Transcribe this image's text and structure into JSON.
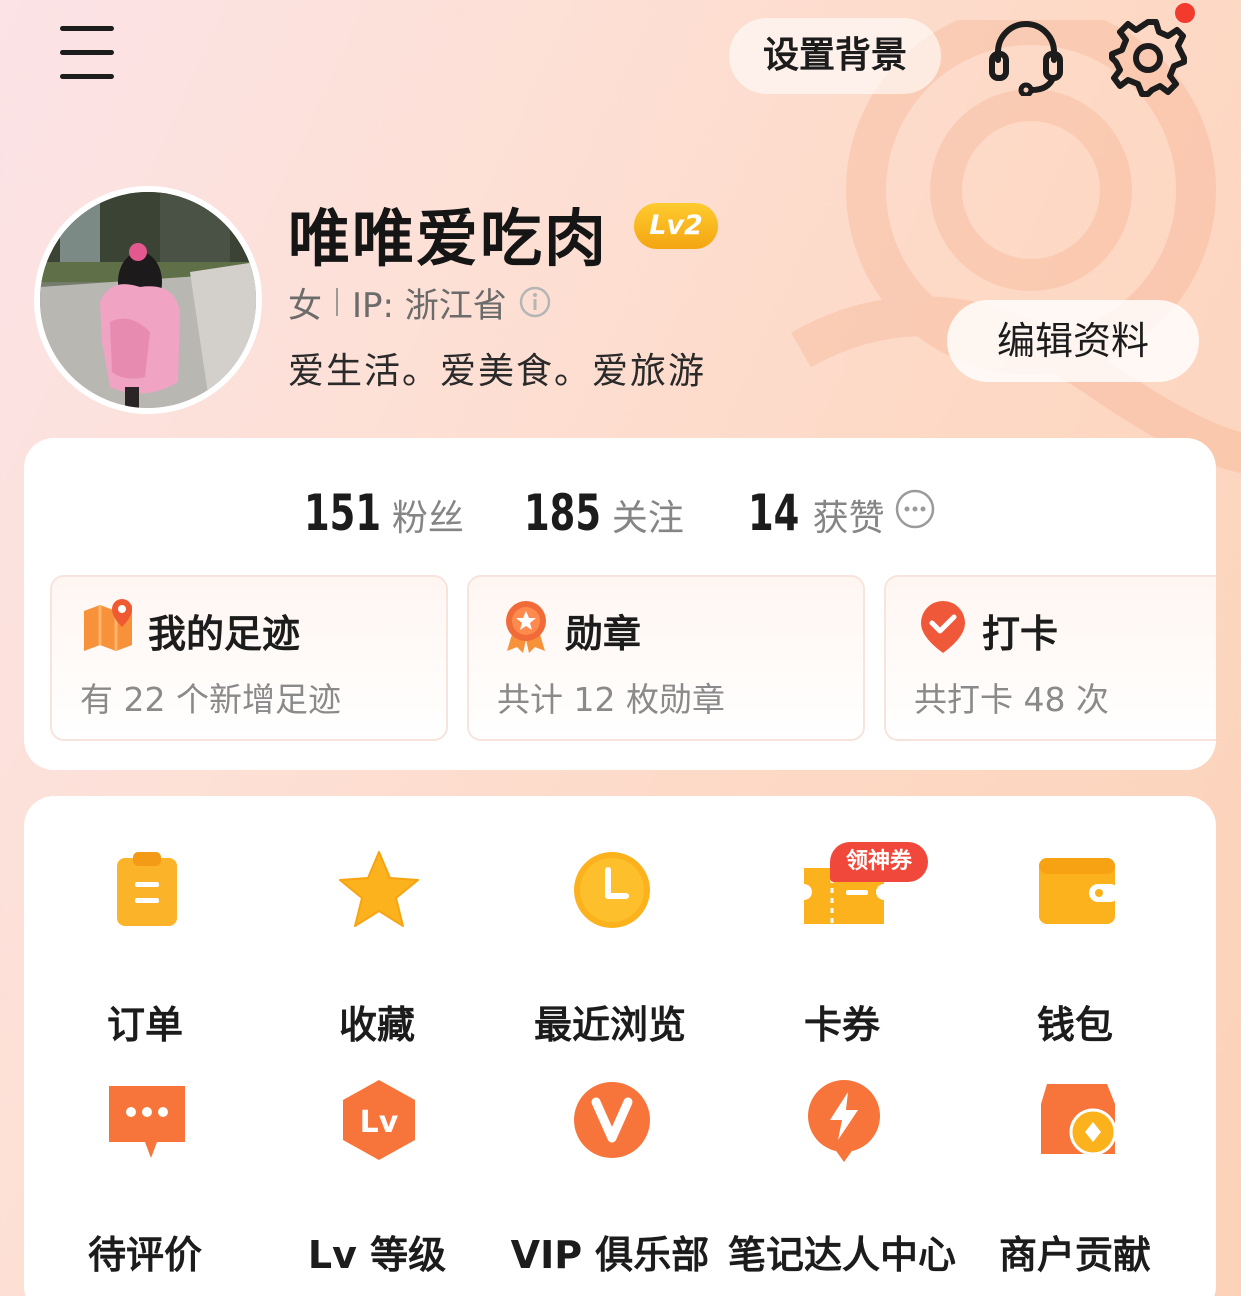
{
  "header": {
    "set_background_label": "设置背景",
    "accent": "#f7a11a"
  },
  "profile": {
    "username": "唯唯爱吃肉",
    "level_badge": "Lv2",
    "gender": "女",
    "ip_location": "IP: 浙江省",
    "bio": "爱生活。爱美食。爱旅游",
    "edit_label": "编辑资料"
  },
  "stats": {
    "fans": {
      "count": "151",
      "label": "粉丝"
    },
    "following": {
      "count": "185",
      "label": "关注"
    },
    "likes": {
      "count": "14",
      "label": "获赞"
    }
  },
  "tiles": [
    {
      "title": "我的足迹",
      "subtitle": "有 22 个新增足迹",
      "icon": "map-pin-icon"
    },
    {
      "title": "勋章",
      "subtitle": "共计 12 枚勋章",
      "icon": "medal-icon"
    },
    {
      "title": "打卡",
      "subtitle": "共打卡 48 次",
      "icon": "checkin-icon"
    }
  ],
  "grid": [
    {
      "label": "订单",
      "icon": "order-icon"
    },
    {
      "label": "收藏",
      "icon": "star-icon"
    },
    {
      "label": "最近浏览",
      "icon": "clock-icon"
    },
    {
      "label": "卡券",
      "icon": "ticket-icon",
      "tag": "领神券"
    },
    {
      "label": "钱包",
      "icon": "wallet-icon"
    },
    {
      "label": "待评价",
      "icon": "comment-icon"
    },
    {
      "label": "Lv 等级",
      "icon": "level-icon"
    },
    {
      "label": "VIP 俱乐部",
      "icon": "vip-icon"
    },
    {
      "label": "笔记达人中心",
      "icon": "bolt-icon"
    },
    {
      "label": "商户贡献",
      "icon": "shop-icon"
    }
  ]
}
